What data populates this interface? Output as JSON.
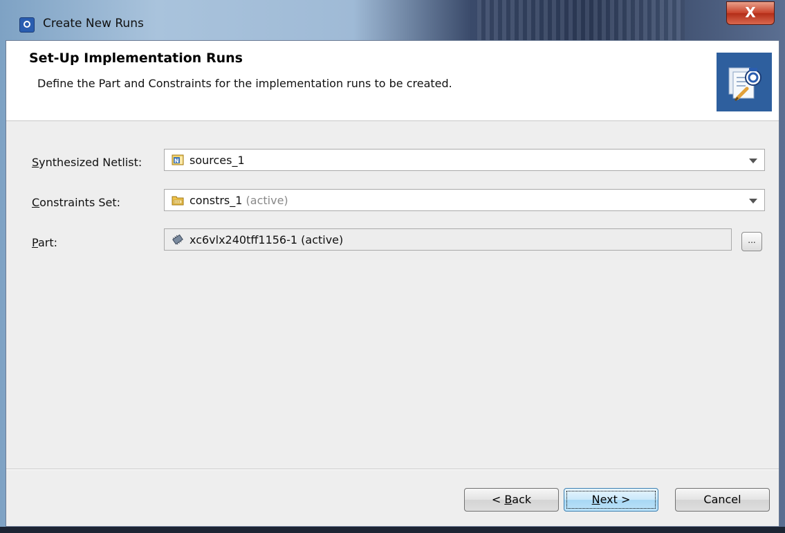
{
  "window": {
    "title": "Create New Runs",
    "close_label": "X"
  },
  "header": {
    "title": "Set-Up Implementation Runs",
    "subtitle": "Define the Part and Constraints for the implementation runs to be created."
  },
  "form": {
    "netlist": {
      "label_accel": "S",
      "label_rest": "ynthesized Netlist:",
      "value": "sources_1",
      "icon": "netlist-icon"
    },
    "constraints": {
      "label_accel": "C",
      "label_rest": "onstraints Set:",
      "value": "constrs_1",
      "value_suffix": "(active)",
      "icon": "folder-icon"
    },
    "part": {
      "label_accel": "P",
      "label_rest": "art:",
      "value": "xc6vlx240tff1156-1 (active)",
      "icon": "chip-icon",
      "browse_label": "..."
    }
  },
  "buttons": {
    "back_prefix": "< ",
    "back_accel": "B",
    "back_rest": "ack",
    "next_accel": "N",
    "next_rest": "ext >",
    "cancel": "Cancel"
  },
  "colors": {
    "header_icon_bg": "#2e5f9e",
    "default_button": "#a7d7f4"
  }
}
